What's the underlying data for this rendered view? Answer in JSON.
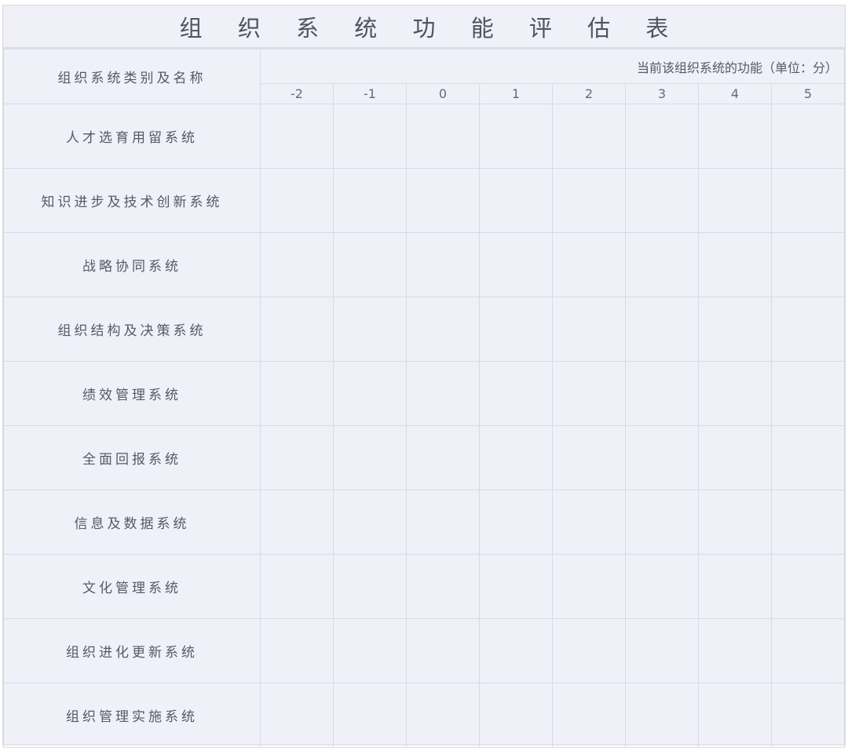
{
  "title": "组 织 系 统 功 能 评 估 表",
  "header": {
    "category_label": "组织系统类别及名称",
    "unit_label": "当前该组织系统的功能（单位：分）",
    "scores": [
      "-2",
      "-1",
      "0",
      "1",
      "2",
      "3",
      "4",
      "5"
    ]
  },
  "rows": [
    {
      "name": "人才选育用留系统"
    },
    {
      "name": "知识进步及技术创新系统"
    },
    {
      "name": "战略协同系统"
    },
    {
      "name": "组织结构及决策系统"
    },
    {
      "name": "绩效管理系统"
    },
    {
      "name": "全面回报系统"
    },
    {
      "name": "信息及数据系统"
    },
    {
      "name": "文化管理系统"
    },
    {
      "name": "组织进化更新系统"
    },
    {
      "name": "组织管理实施系统"
    }
  ]
}
